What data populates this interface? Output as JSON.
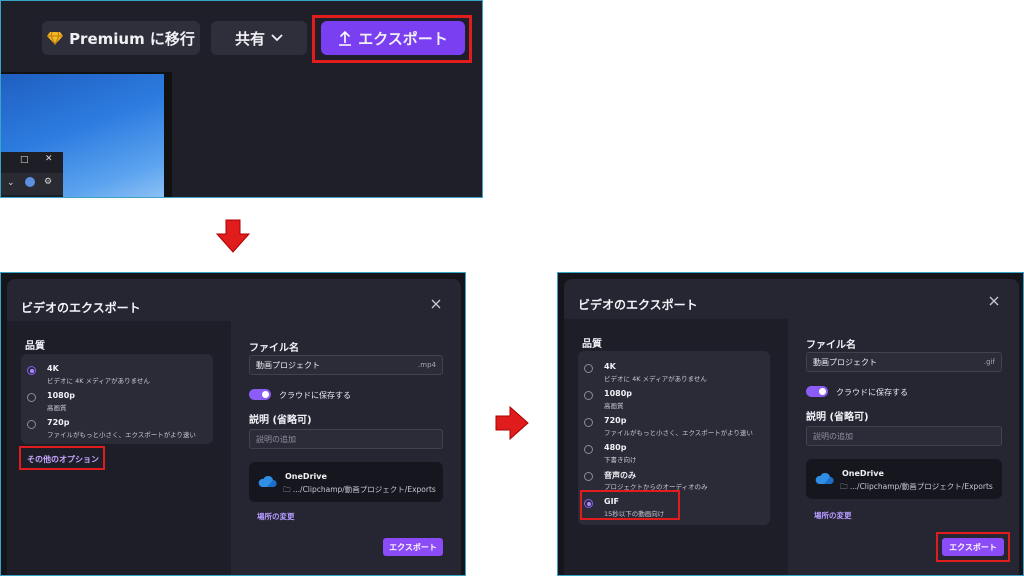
{
  "top": {
    "premium_label": "Premium に移行",
    "share_label": "共有",
    "export_label": "エクスポート",
    "accent_color": "#7b3ff2",
    "highlight_color": "#e01c1c"
  },
  "dialog1": {
    "title": "ビデオのエクスポート",
    "quality_label": "品質",
    "qualities": [
      {
        "name": "4K",
        "desc": "ビデオに 4K メディアがありません"
      },
      {
        "name": "1080p",
        "desc": "高画質"
      },
      {
        "name": "720p",
        "desc": "ファイルがもっと小さく、エクスポートがより速い"
      }
    ],
    "more_options": "その他のオプション",
    "filename_label": "ファイル名",
    "filename_value": "動画プロジェクト",
    "filename_ext": ".mp4",
    "cloud_label": "クラウドに保存する",
    "desc_label": "説明 (省略可)",
    "desc_placeholder": "説明の追加",
    "onedrive_name": "OneDrive",
    "onedrive_path": ".../Clipchamp/動画プロジェクト/Exports",
    "change_location": "場所の変更",
    "export_label": "エクスポート"
  },
  "dialog2": {
    "title": "ビデオのエクスポート",
    "quality_label": "品質",
    "qualities": [
      {
        "name": "4K",
        "desc": "ビデオに 4K メディアがありません"
      },
      {
        "name": "1080p",
        "desc": "高画質"
      },
      {
        "name": "720p",
        "desc": "ファイルがもっと小さく、エクスポートがより速い"
      },
      {
        "name": "480p",
        "desc": "下書き向け"
      },
      {
        "name": "音声のみ",
        "desc": "プロジェクトからのオーディオのみ"
      },
      {
        "name": "GIF",
        "desc": "15秒以下の動画向け"
      }
    ],
    "filename_label": "ファイル名",
    "filename_value": "動画プロジェクト",
    "filename_ext": ".gif",
    "cloud_label": "クラウドに保存する",
    "desc_label": "説明 (省略可)",
    "desc_placeholder": "説明の追加",
    "onedrive_name": "OneDrive",
    "onedrive_path": ".../Clipchamp/動画プロジェクト/Exports",
    "change_location": "場所の変更",
    "export_label": "エクスポート"
  }
}
